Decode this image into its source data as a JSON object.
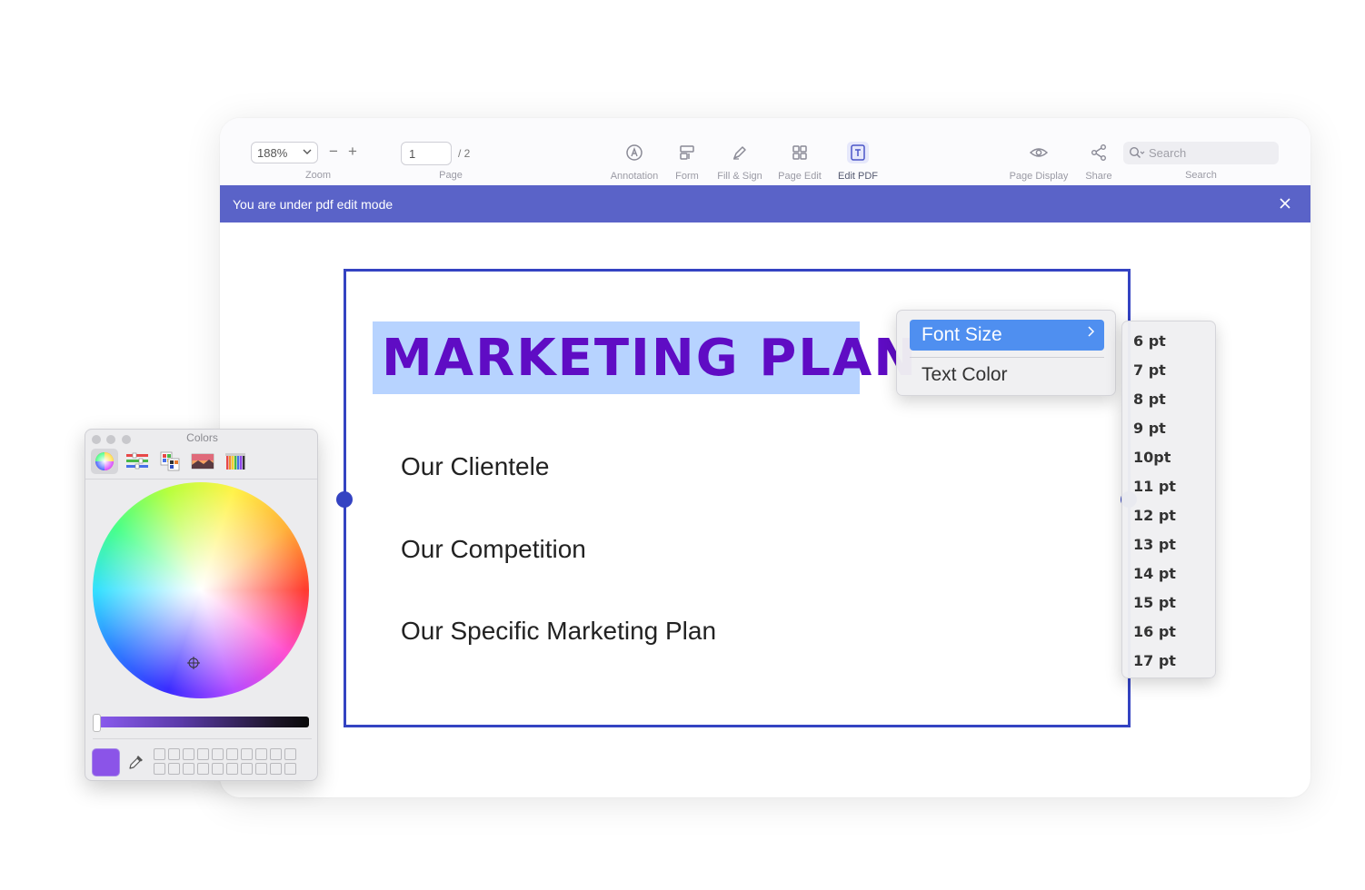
{
  "toolbar": {
    "zoom_value": "188%",
    "zoom_caption": "Zoom",
    "zoom_out": "−",
    "zoom_in": "+",
    "page_value": "1",
    "page_total": "/ 2",
    "page_caption": "Page",
    "tools": [
      {
        "label": "Annotation",
        "icon": "annotation-icon"
      },
      {
        "label": "Form",
        "icon": "form-icon"
      },
      {
        "label": "Fill & Sign",
        "icon": "pen-icon"
      },
      {
        "label": "Page Edit",
        "icon": "grid-icon"
      },
      {
        "label": "Edit PDF",
        "icon": "edit-text-icon",
        "active": true
      }
    ],
    "page_display_label": "Page Display",
    "share_label": "Share",
    "search_placeholder": "Search",
    "search_caption": "Search"
  },
  "banner": {
    "text": "You are under pdf edit mode",
    "color": "#5a63c8"
  },
  "document": {
    "title": "MARKETING PLAN",
    "title_color": "#5f0cc4",
    "lines": [
      "Our Clientele",
      "Our Competition",
      "Our Specific Marketing Plan"
    ],
    "frame_color": "#3443c2"
  },
  "context_menu": {
    "items": [
      {
        "label": "Font Size",
        "highlighted": true,
        "has_submenu": true
      },
      {
        "label": "Text Color"
      }
    ],
    "highlight_color": "#4f8ff0"
  },
  "font_size_menu": [
    "6 pt",
    "7 pt",
    "8 pt",
    "9 pt",
    "10pt",
    "11 pt",
    "12 pt",
    "13 pt",
    "14 pt",
    "15 pt",
    "16 pt",
    "17 pt"
  ],
  "colors_panel": {
    "title": "Colors",
    "selected_color": "#8b54e8",
    "tabs": [
      "color-wheel-icon",
      "sliders-icon",
      "palettes-icon",
      "image-palette-icon",
      "pencils-icon"
    ]
  }
}
